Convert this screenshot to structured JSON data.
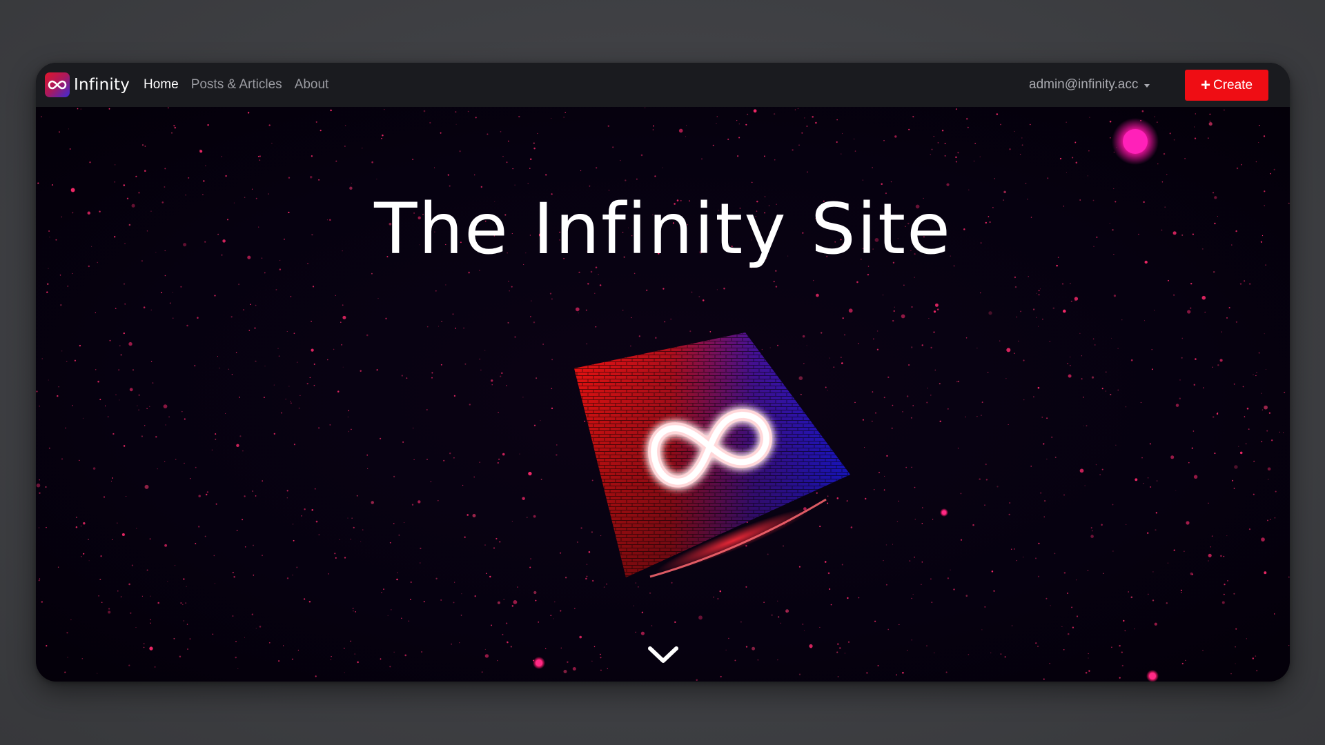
{
  "navbar": {
    "brand": {
      "name": "Infinity",
      "logo_icon": "infinity-icon"
    },
    "links": [
      {
        "label": "Home",
        "active": true
      },
      {
        "label": "Posts & Articles",
        "active": false
      },
      {
        "label": "About",
        "active": false
      }
    ],
    "user": {
      "email": "admin@infinity.acc",
      "dropdown_icon": "caret-down-icon"
    },
    "create_button": {
      "label": "Create",
      "icon": "plus-icon"
    }
  },
  "hero": {
    "title": "The Infinity Site",
    "centerpiece_icon": "infinity-cube-icon",
    "scroll_icon": "chevron-down-icon"
  },
  "colors": {
    "accent": "#ef0d14",
    "navbar_bg": "#1a1b1f",
    "hero_bg": "#06020e",
    "star": "#ff2a6d",
    "orb": "#ff1aa8"
  }
}
